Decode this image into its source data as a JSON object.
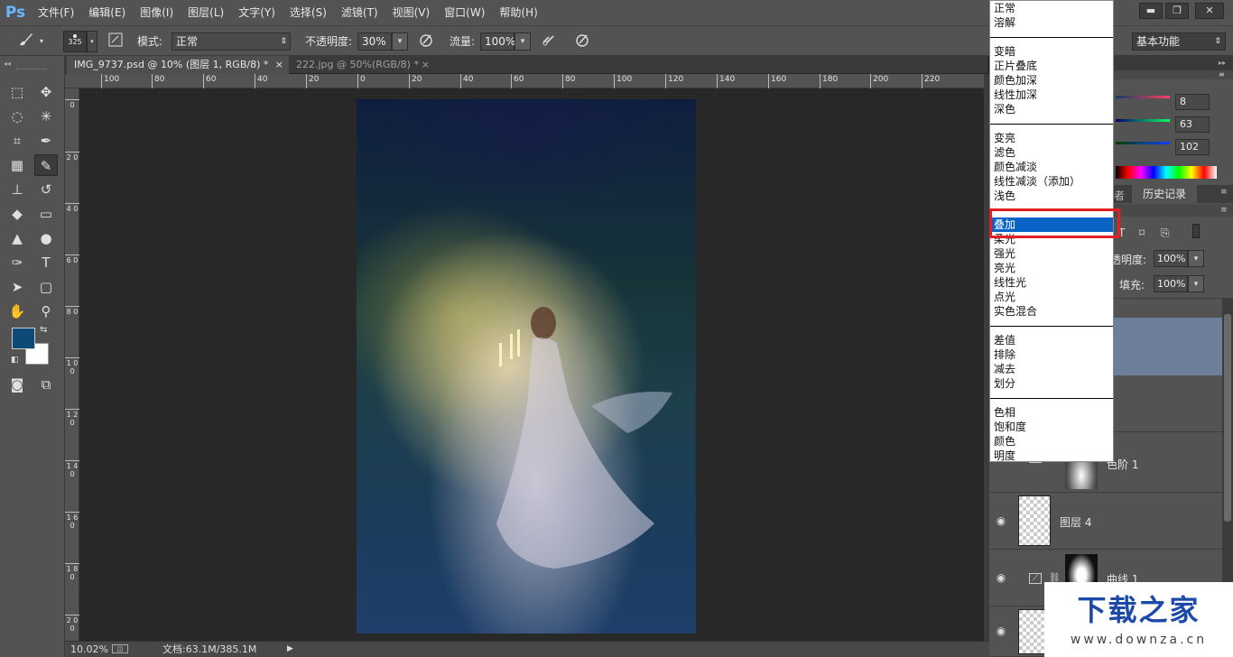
{
  "app": {
    "logo": "Ps"
  },
  "menubar": {
    "items": [
      "文件(F)",
      "编辑(E)",
      "图像(I)",
      "图层(L)",
      "文字(Y)",
      "选择(S)",
      "滤镜(T)",
      "视图(V)",
      "窗口(W)",
      "帮助(H)"
    ]
  },
  "window_controls": {
    "minimize": "▬",
    "restore": "❐",
    "close": "✕"
  },
  "options": {
    "brush_size": "325",
    "mode_label": "模式:",
    "mode_value": "正常",
    "opacity_label": "不透明度:",
    "opacity_value": "30%",
    "flow_label": "流量:",
    "flow_value": "100%",
    "workspace": "基本功能"
  },
  "tabs": [
    {
      "label": "IMG_9737.psd @ 10% (图层 1, RGB/8) *",
      "close": "×"
    },
    {
      "label": "222.jpg @ 50%(RGB/8) *",
      "close": "×"
    }
  ],
  "hruler": [
    "100",
    "80",
    "60",
    "40",
    "20",
    "0",
    "20",
    "40",
    "60",
    "80",
    "100",
    "120",
    "140",
    "160",
    "180",
    "200",
    "220"
  ],
  "vruler": [
    "0",
    "2 0",
    "4 0",
    "6 0",
    "8 0",
    "1 0 0",
    "1 2 0",
    "1 4 0",
    "1 6 0",
    "1 8 0",
    "2 0 0"
  ],
  "status": {
    "zoom": "10.02%",
    "doc": "文档:63.1M/385.1M"
  },
  "color_panel": {
    "r": "8",
    "g": "63",
    "b": "102"
  },
  "panel_tabs": {
    "history": "历史记录",
    "partial": "者"
  },
  "layers_panel": {
    "opacity_label": "透明度:",
    "opacity_value": "100%",
    "fill_label": "填充:",
    "fill_value": "100%",
    "layers": [
      {
        "name": "色阶 1"
      },
      {
        "name": "图层 4"
      },
      {
        "name": "曲线 1"
      }
    ]
  },
  "blend_modes": {
    "groups": [
      [
        "正常",
        "溶解"
      ],
      [
        "变暗",
        "正片叠底",
        "颜色加深",
        "线性加深",
        "深色"
      ],
      [
        "变亮",
        "滤色",
        "颜色减淡",
        "线性减淡（添加）",
        "浅色"
      ],
      [
        "叠加",
        "柔光",
        "强光",
        "亮光",
        "线性光",
        "点光",
        "实色混合"
      ],
      [
        "差值",
        "排除",
        "减去",
        "划分"
      ],
      [
        "色相",
        "饱和度",
        "颜色",
        "明度"
      ]
    ],
    "selected": "叠加"
  },
  "colors": {
    "foreground": "#0e4a78",
    "background": "#ffffff",
    "selection": "#0a64c8",
    "highlight": "#e31e24"
  },
  "watermark": {
    "title": "下载之家",
    "url": "www.downza.cn"
  }
}
